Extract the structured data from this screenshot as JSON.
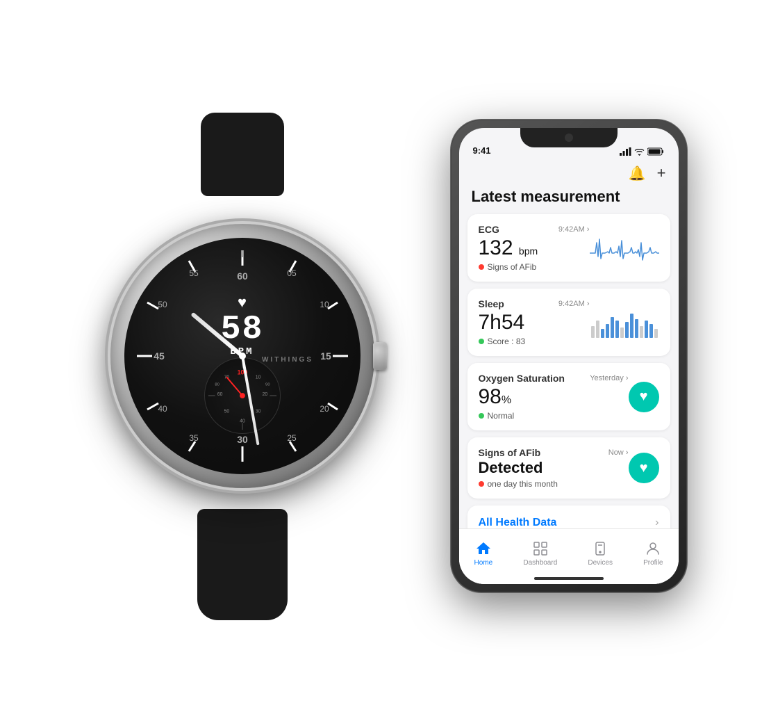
{
  "watch": {
    "bpm_number": "58",
    "bpm_label": "BPM",
    "brand": "WITHINGS",
    "sub_scale_100": "100",
    "sub_scale_90": "90",
    "sub_scale_80": "80",
    "sub_scale_70": "70",
    "sub_scale_60": "60",
    "sub_scale_50": "50",
    "sub_scale_40": "40",
    "sub_scale_30": "30",
    "sub_scale_20": "20",
    "sub_scale_10": "10"
  },
  "phone": {
    "status_time": "9:41",
    "title": "Latest measurement",
    "topbar_bell": "🔔",
    "topbar_plus": "+",
    "ecg": {
      "title": "ECG",
      "timestamp": "9:42AM",
      "value": "132",
      "unit": "bpm",
      "status_dot": "red",
      "status_text": "Signs of AFib"
    },
    "sleep": {
      "title": "Sleep",
      "timestamp": "9:42AM",
      "value_h": "7h",
      "value_m": "54",
      "status_dot": "green",
      "status_text": "Score : 83"
    },
    "oxygen": {
      "title": "Oxygen Saturation",
      "timestamp": "Yesterday",
      "value": "98",
      "unit": "%",
      "status_dot": "green",
      "status_text": "Normal"
    },
    "afib": {
      "title": "Signs of AFib",
      "subtitle": "Detected",
      "timestamp": "Now",
      "status_dot": "red",
      "status_text": "one day this month"
    },
    "all_health": {
      "label": "All Health Data",
      "chevron": "›"
    },
    "nav": {
      "home_label": "Home",
      "dashboard_label": "Dashboard",
      "devices_label": "Devices",
      "profile_label": "Profile"
    }
  }
}
